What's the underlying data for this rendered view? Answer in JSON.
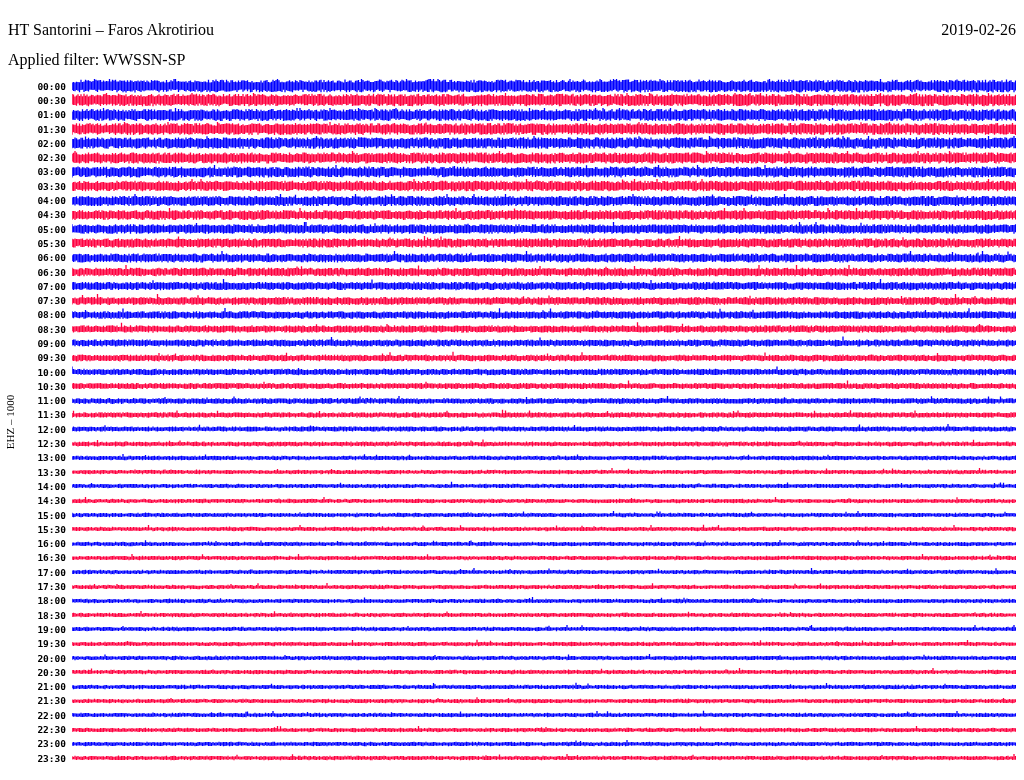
{
  "header": {
    "title": "HT Santorini – Faros Akrotiriou",
    "date": "2019-02-26",
    "filter": "Applied filter: WWSSN-SP"
  },
  "channel_label": "EHZ – 1000",
  "rows": [
    {
      "time": "00:00",
      "color": "#0000ff"
    },
    {
      "time": "00:30",
      "color": "#ff0040"
    },
    {
      "time": "01:00",
      "color": "#0000ff"
    },
    {
      "time": "01:30",
      "color": "#ff0040"
    },
    {
      "time": "02:00",
      "color": "#0000ff"
    },
    {
      "time": "02:30",
      "color": "#ff0040"
    },
    {
      "time": "03:00",
      "color": "#0000ff"
    },
    {
      "time": "03:30",
      "color": "#ff0040"
    },
    {
      "time": "04:00",
      "color": "#0000ff"
    },
    {
      "time": "04:30",
      "color": "#ff0040"
    },
    {
      "time": "05:00",
      "color": "#0000ff"
    },
    {
      "time": "05:30",
      "color": "#ff0040"
    },
    {
      "time": "06:00",
      "color": "#0000ff"
    },
    {
      "time": "06:30",
      "color": "#ff0040"
    },
    {
      "time": "07:00",
      "color": "#0000ff"
    },
    {
      "time": "07:30",
      "color": "#ff0040"
    },
    {
      "time": "08:00",
      "color": "#0000ff"
    },
    {
      "time": "08:30",
      "color": "#ff0040"
    },
    {
      "time": "09:00",
      "color": "#0000ff"
    },
    {
      "time": "09:30",
      "color": "#ff0040"
    },
    {
      "time": "10:00",
      "color": "#0000ff"
    },
    {
      "time": "10:30",
      "color": "#ff0040"
    },
    {
      "time": "11:00",
      "color": "#0000ff"
    },
    {
      "time": "11:30",
      "color": "#ff0040"
    },
    {
      "time": "12:00",
      "color": "#0000ff"
    },
    {
      "time": "12:30",
      "color": "#ff0040"
    },
    {
      "time": "13:00",
      "color": "#0000ff"
    },
    {
      "time": "13:30",
      "color": "#ff0040"
    },
    {
      "time": "14:00",
      "color": "#0000ff"
    },
    {
      "time": "14:30",
      "color": "#ff0040"
    },
    {
      "time": "15:00",
      "color": "#0000ff"
    },
    {
      "time": "15:30",
      "color": "#ff0040"
    },
    {
      "time": "16:00",
      "color": "#0000ff"
    },
    {
      "time": "16:30",
      "color": "#ff0040"
    },
    {
      "time": "17:00",
      "color": "#0000ff"
    },
    {
      "time": "17:30",
      "color": "#ff0040"
    },
    {
      "time": "18:00",
      "color": "#0000ff"
    },
    {
      "time": "18:30",
      "color": "#ff0040"
    },
    {
      "time": "19:00",
      "color": "#0000ff"
    },
    {
      "time": "19:30",
      "color": "#ff0040"
    },
    {
      "time": "20:00",
      "color": "#0000ff"
    },
    {
      "time": "20:30",
      "color": "#ff0040"
    },
    {
      "time": "21:00",
      "color": "#0000ff"
    },
    {
      "time": "21:30",
      "color": "#ff0040"
    },
    {
      "time": "22:00",
      "color": "#0000ff"
    },
    {
      "time": "22:30",
      "color": "#ff0040"
    },
    {
      "time": "23:00",
      "color": "#0000ff"
    },
    {
      "time": "23:30",
      "color": "#ff0040"
    }
  ]
}
